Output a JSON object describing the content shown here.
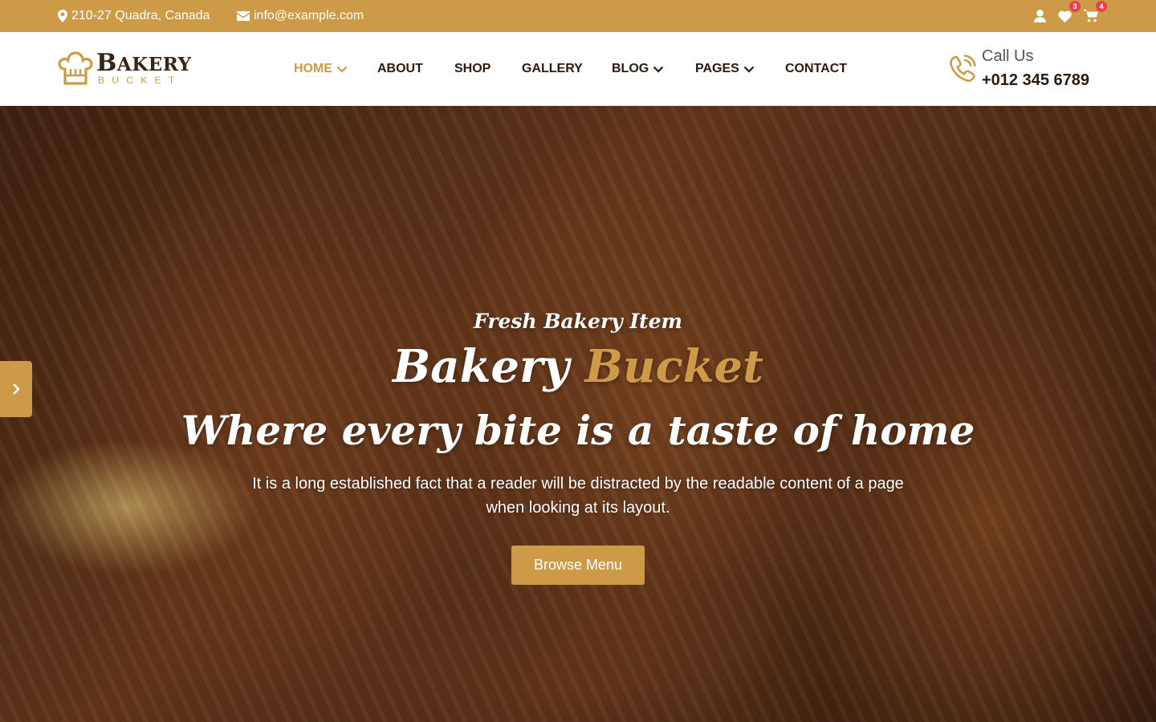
{
  "colors": {
    "accent": "#CD9A48",
    "dark": "#2B1A10",
    "badge": "#E8404F"
  },
  "topbar": {
    "address": "210-27 Quadra, Canada",
    "email": "info@example.com",
    "wishlist_count": "3",
    "cart_count": "4",
    "icons": [
      "map-pin-icon",
      "envelope-icon",
      "user-icon",
      "heart-icon",
      "cart-icon"
    ]
  },
  "logo": {
    "word_first": "B",
    "word_rest": "AKERY",
    "sub": "BUCKET"
  },
  "nav": {
    "home": "HOME",
    "about": "ABOUT",
    "shop": "SHOP",
    "gallery": "GALLERY",
    "blog": "BLOG",
    "pages": "PAGES",
    "contact": "CONTACT",
    "active": "home"
  },
  "call": {
    "label": "Call Us",
    "number": "+012 345 6789"
  },
  "hero": {
    "eyebrow": "Fresh Bakery Item",
    "title_plain": "Bakery",
    "title_accent": "Bucket",
    "subtitle": "Where every bite is a taste of home",
    "paragraph": "It is a long established fact that a reader will be distracted by the readable content of a page when looking at its layout.",
    "button": "Browse Menu"
  }
}
